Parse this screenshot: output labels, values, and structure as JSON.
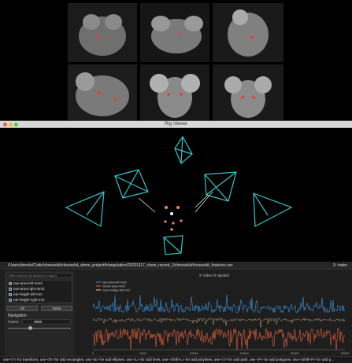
{
  "rig_viewer": {
    "title": "Rig Viewer"
  },
  "feature_panel": {
    "path": "/Users/donnie/Code/cheesekit/cheesekit_demo_project/triangulation/20231117_chew_record_1/cheesekit/cheesekit_features.csv",
    "axis_selector": "X: index",
    "filter_placeholder": "Filter columns (substring or regex)",
    "features": [
      "eye-area-left-mm2",
      "eye-area-right-mm2",
      "ear-height-left-mm",
      "ear-height-right-mm"
    ],
    "all_label": "All",
    "none_label": "None",
    "navigation_label": "Navigation",
    "frame_label": "Frame:",
    "frame_value": "8888"
  },
  "plot": {
    "title": "X: index (3 signals)",
    "legend": [
      "eye-area-left-mm2",
      "mouth-area-mm2",
      "nose-bridge-dist-mm"
    ],
    "colors": [
      "#3b8fd6",
      "#e0623f",
      "#e8c89a"
    ],
    "x_ticks": [
      "0",
      "5000",
      "10000",
      "15000",
      "20000",
      "25000"
    ]
  },
  "status": {
    "text": "use <T> for transform, use <R> for add rectangles, use <E> for add ellipses, use <L> for add lines, use <Shift+L> for add polylines, use <T> for add path, use <P> for add polygons, use <Shift+P> for add p..."
  },
  "chart_data": {
    "type": "line",
    "title": "X: index (3 signals)",
    "x_range": [
      0,
      27000
    ],
    "series": [
      {
        "name": "eye-area-left-mm2",
        "values": []
      },
      {
        "name": "mouth-area-mm2",
        "values": []
      },
      {
        "name": "nose-bridge-dist-mm",
        "values": []
      }
    ]
  }
}
